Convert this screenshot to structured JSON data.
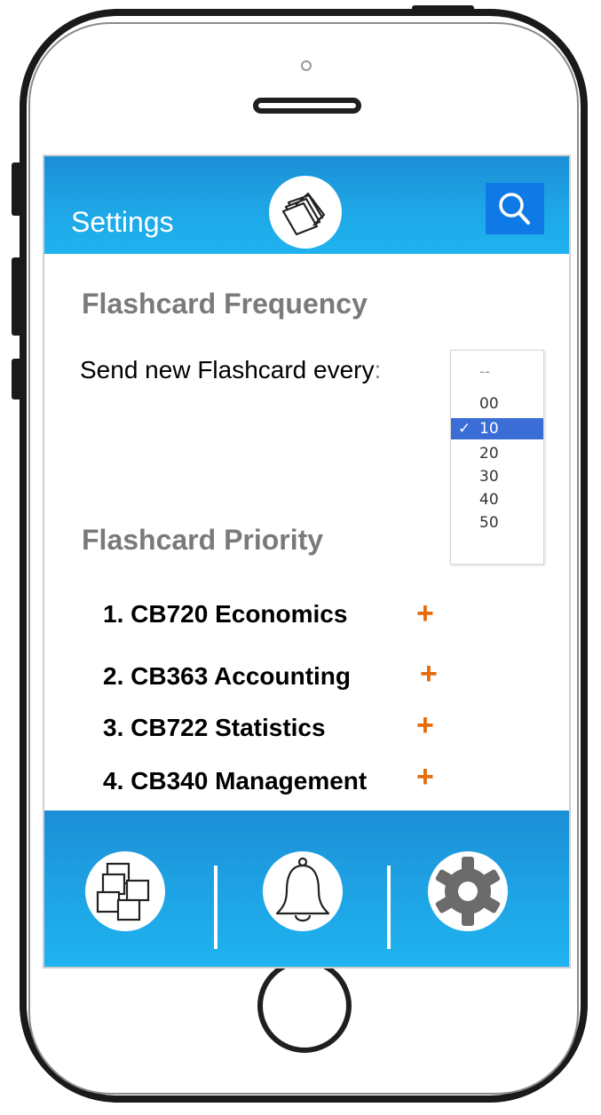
{
  "header": {
    "title": "Settings",
    "logo_icon": "flashcards-stack-icon",
    "search_icon": "search-icon"
  },
  "frequency": {
    "heading": "Flashcard Frequency",
    "label": "Send new Flashcard every",
    "label_colon": ":",
    "dropdown": {
      "options": [
        "--",
        "00",
        "10",
        "20",
        "30",
        "40",
        "50"
      ],
      "selected": "10",
      "check_glyph": "✓"
    }
  },
  "priority": {
    "heading": "Flashcard Priority",
    "items": [
      {
        "label": "1. CB720 Economics",
        "action": "+"
      },
      {
        "label": "2. CB363 Accounting",
        "action": "+"
      },
      {
        "label": "3. CB722 Statistics",
        "action": "+"
      },
      {
        "label": "4. CB340 Management",
        "action": "+"
      }
    ]
  },
  "bottom_nav": {
    "items": [
      {
        "icon": "flashcards-icon"
      },
      {
        "icon": "bell-icon"
      },
      {
        "icon": "gear-icon"
      }
    ]
  },
  "colors": {
    "bar_blue": "#1ea6e6",
    "search_blue": "#0f7ae6",
    "plus_orange": "#e46c0a",
    "heading_gray": "#7a7a7a",
    "select_blue": "#3a6ed6"
  }
}
